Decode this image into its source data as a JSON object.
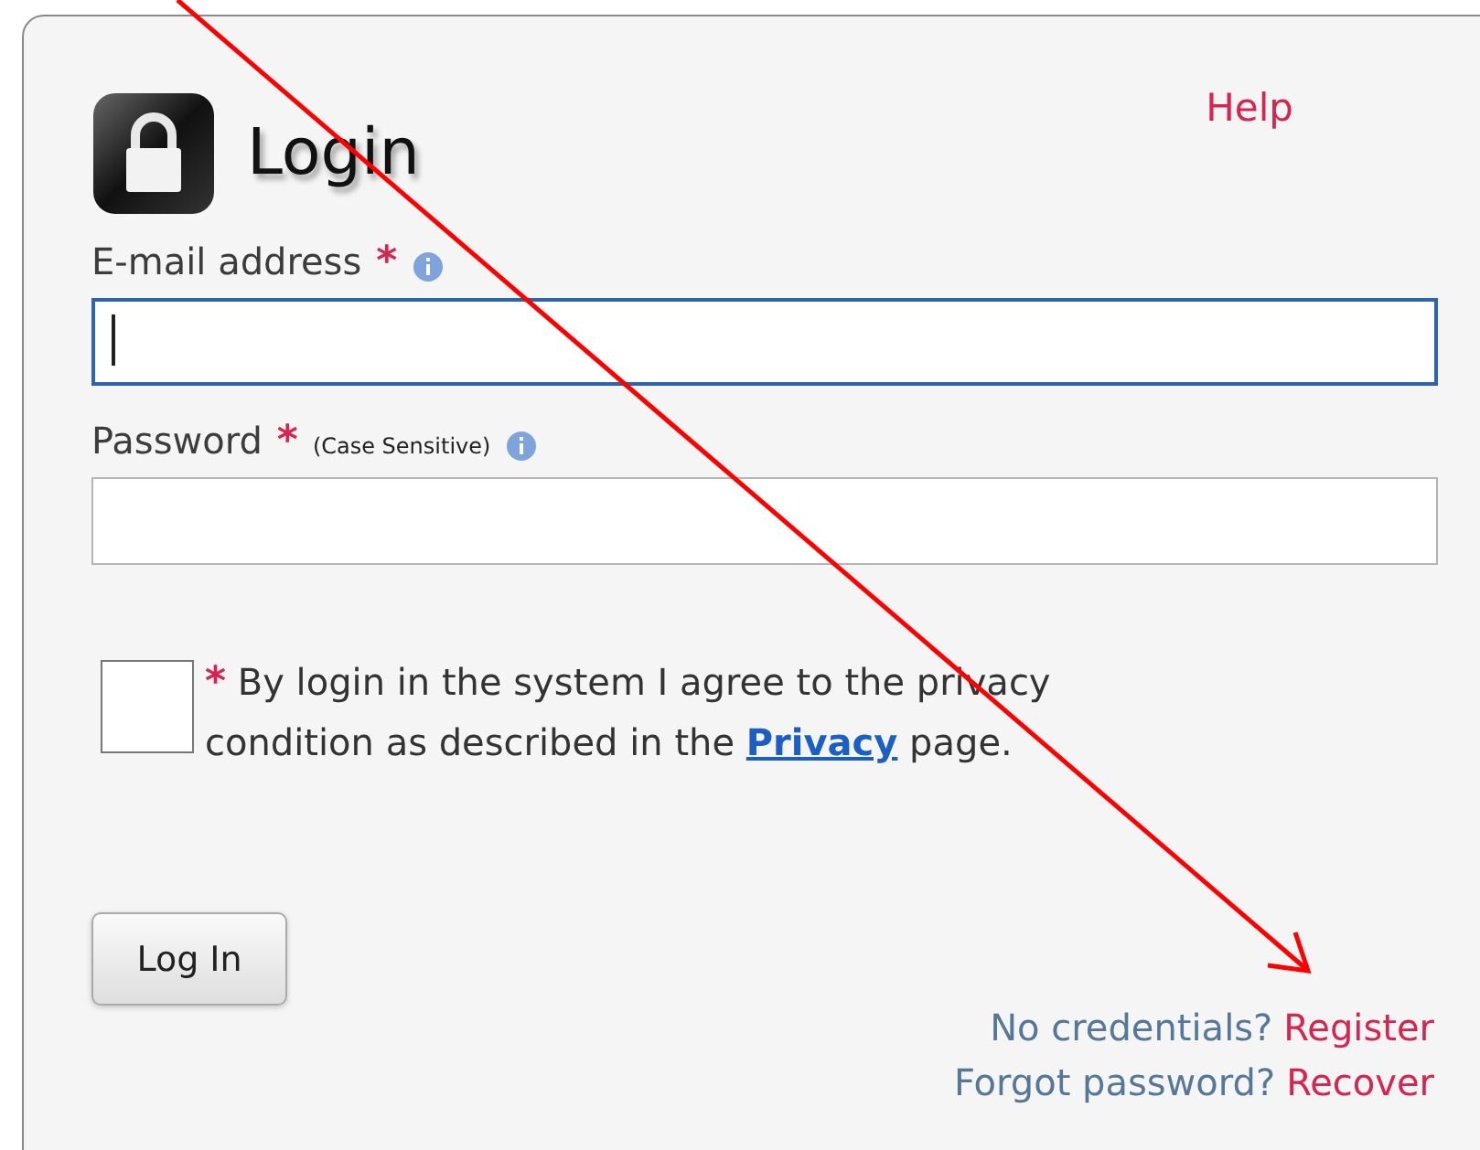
{
  "title": "Login",
  "help": "Help",
  "fields": [
    {
      "label": "E-mail address",
      "required_mark": "*",
      "info": true,
      "focused": true
    },
    {
      "label": "Password",
      "required_mark": "*",
      "hint": "(Case Sensitive)",
      "info": true,
      "focused": false
    }
  ],
  "agreement": {
    "checked": false,
    "required_mark": "*",
    "text_before": "By login in the system I agree to the privacy condition as described in the ",
    "link": "Privacy",
    "text_after": " page."
  },
  "button": "Log In",
  "links": [
    {
      "prompt": "No credentials?",
      "action": "Register"
    },
    {
      "prompt": "Forgot password?",
      "action": "Recover"
    }
  ]
}
